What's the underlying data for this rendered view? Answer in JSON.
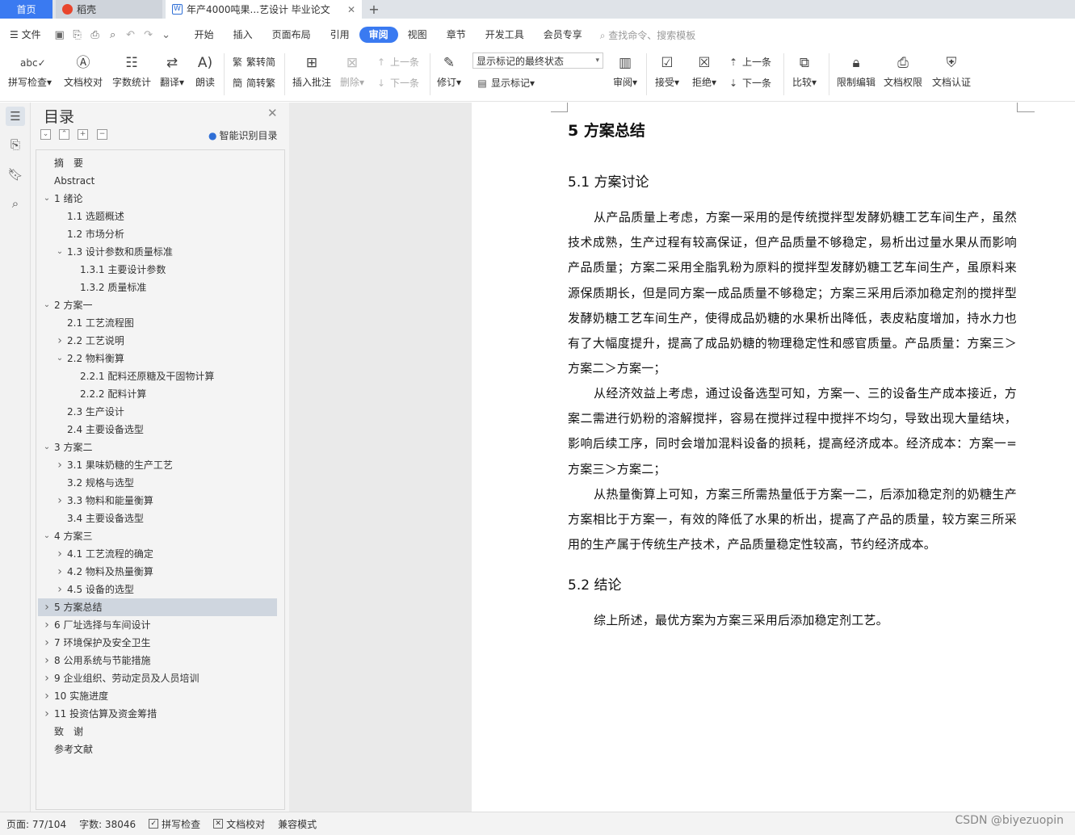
{
  "tabs": {
    "home": "首页",
    "daoke": "稻壳",
    "doc": "年产4000吨果...艺设计 毕业论文"
  },
  "menu": {
    "file": "文件",
    "items": [
      "开始",
      "插入",
      "页面布局",
      "引用",
      "审阅",
      "视图",
      "章节",
      "开发工具",
      "会员专享"
    ],
    "active_index": 4,
    "search_placeholder": "查找命令、搜索模板"
  },
  "ribbon": {
    "spell": "拼写检查",
    "proofread": "文档校对",
    "wordcount": "字数统计",
    "translate": "翻译",
    "read": "朗读",
    "trad": "繁转简",
    "simp": "简转繁",
    "insert_comment": "插入批注",
    "delete": "删除",
    "prev_c": "上一条",
    "next_c": "下一条",
    "track": "修订",
    "markup_select": "显示标记的最终状态",
    "show_markup": "显示标记",
    "review": "审阅",
    "accept": "接受",
    "reject": "拒绝",
    "prev": "上一条",
    "next": "下一条",
    "compare": "比较",
    "restrict": "限制编辑",
    "perm": "文档权限",
    "auth": "文档认证"
  },
  "toc": {
    "title": "目录",
    "smart": "智能识别目录",
    "items": [
      {
        "label": "摘　要",
        "level": 0,
        "caret": ""
      },
      {
        "label": "Abstract",
        "level": 0,
        "caret": ""
      },
      {
        "label": "1 绪论",
        "level": 0,
        "caret": "down"
      },
      {
        "label": "1.1 选题概述",
        "level": 1,
        "caret": ""
      },
      {
        "label": "1.2 市场分析",
        "level": 1,
        "caret": ""
      },
      {
        "label": "1.3 设计参数和质量标准",
        "level": 1,
        "caret": "down"
      },
      {
        "label": "1.3.1 主要设计参数",
        "level": 2,
        "caret": ""
      },
      {
        "label": "1.3.2 质量标准",
        "level": 2,
        "caret": ""
      },
      {
        "label": "2 方案一",
        "level": 0,
        "caret": "down"
      },
      {
        "label": "2.1 工艺流程图",
        "level": 1,
        "caret": ""
      },
      {
        "label": "2.2 工艺说明",
        "level": 1,
        "caret": "right"
      },
      {
        "label": "2.2 物料衡算",
        "level": 1,
        "caret": "down"
      },
      {
        "label": "2.2.1 配料还原糖及干固物计算",
        "level": 2,
        "caret": ""
      },
      {
        "label": "2.2.2 配料计算",
        "level": 2,
        "caret": ""
      },
      {
        "label": "2.3 生产设计",
        "level": 1,
        "caret": ""
      },
      {
        "label": "2.4 主要设备选型",
        "level": 1,
        "caret": ""
      },
      {
        "label": "3 方案二",
        "level": 0,
        "caret": "down"
      },
      {
        "label": "3.1 果味奶糖的生产工艺",
        "level": 1,
        "caret": "right"
      },
      {
        "label": "3.2 规格与选型",
        "level": 1,
        "caret": ""
      },
      {
        "label": "3.3 物料和能量衡算",
        "level": 1,
        "caret": "right"
      },
      {
        "label": "3.4 主要设备选型",
        "level": 1,
        "caret": ""
      },
      {
        "label": "4 方案三",
        "level": 0,
        "caret": "down"
      },
      {
        "label": "4.1 工艺流程的确定",
        "level": 1,
        "caret": "right"
      },
      {
        "label": "4.2 物料及热量衡算",
        "level": 1,
        "caret": "right"
      },
      {
        "label": "4.5 设备的选型",
        "level": 1,
        "caret": "right"
      },
      {
        "label": "5 方案总结",
        "level": 0,
        "caret": "right",
        "selected": true
      },
      {
        "label": "6 厂址选择与车间设计",
        "level": 0,
        "caret": "right"
      },
      {
        "label": "7 环境保护及安全卫生",
        "level": 0,
        "caret": "right"
      },
      {
        "label": "8 公用系统与节能措施",
        "level": 0,
        "caret": "right"
      },
      {
        "label": "9 企业组织、劳动定员及人员培训",
        "level": 0,
        "caret": "right"
      },
      {
        "label": "10 实施进度",
        "level": 0,
        "caret": "right"
      },
      {
        "label": "11 投资估算及资金筹措",
        "level": 0,
        "caret": "right"
      },
      {
        "label": "致　谢",
        "level": 0,
        "caret": ""
      },
      {
        "label": "参考文献",
        "level": 0,
        "caret": ""
      }
    ]
  },
  "document": {
    "h1": "5 方案总结",
    "h2a": "5.1 方案讨论",
    "p1": "从产品质量上考虑，方案一采用的是传统搅拌型发酵奶糖工艺车间生产，虽然技术成熟，生产过程有较高保证，但产品质量不够稳定，易析出过量水果从而影响产品质量；方案二采用全脂乳粉为原料的搅拌型发酵奶糖工艺车间生产，虽原料来源保质期长，但是同方案一成品质量不够稳定；方案三采用后添加稳定剂的搅拌型发酵奶糖工艺车间生产，使得成品奶糖的水果析出降低，表皮粘度增加，持水力也有了大幅度提升，提高了成品奶糖的物理稳定性和感官质量。产品质量：方案三＞方案二＞方案一；",
    "p2": "从经济效益上考虑，通过设备选型可知，方案一、三的设备生产成本接近，方案二需进行奶粉的溶解搅拌，容易在搅拌过程中搅拌不均匀，导致出现大量结块，影响后续工序，同时会增加混料设备的损耗，提高经济成本。经济成本：方案一=方案三＞方案二；",
    "p3": "从热量衡算上可知，方案三所需热量低于方案一二，后添加稳定剂的奶糖生产方案相比于方案一，有效的降低了水果的析出，提高了产品的质量，较方案三所采用的生产属于传统生产技术，产品质量稳定性较高，节约经济成本。",
    "h2b": "5.2 结论",
    "p4": "综上所述，最优方案为方案三采用后添加稳定剂工艺。"
  },
  "status": {
    "page": "页面: 77/104",
    "words": "字数: 38046",
    "spell": "拼写检查",
    "proof": "文档校对",
    "compat": "兼容模式"
  },
  "watermark": "CSDN @biyezuopin",
  "colors": {
    "accent": "#3a7af1",
    "selected_row": "#cfd6df"
  }
}
